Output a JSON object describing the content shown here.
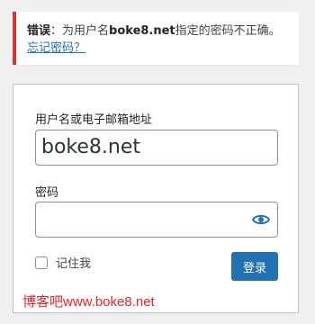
{
  "error": {
    "label": "错误",
    "colon": "：为用户名",
    "username": "boke8.net",
    "message": "指定的密码不正确。",
    "forgot_link": "忘记密码？",
    "accent_color": "#d63638"
  },
  "form": {
    "username_label": "用户名或电子邮箱地址",
    "username_value": "boke8.net",
    "password_label": "密码",
    "password_value": "",
    "toggle_icon": "eye-icon",
    "remember_label": "记住我",
    "remember_checked": false,
    "submit_label": "登录",
    "accent_color": "#2271b1"
  },
  "watermark": {
    "text": "博客吧www.boke8.net",
    "color": "#e8212b"
  }
}
